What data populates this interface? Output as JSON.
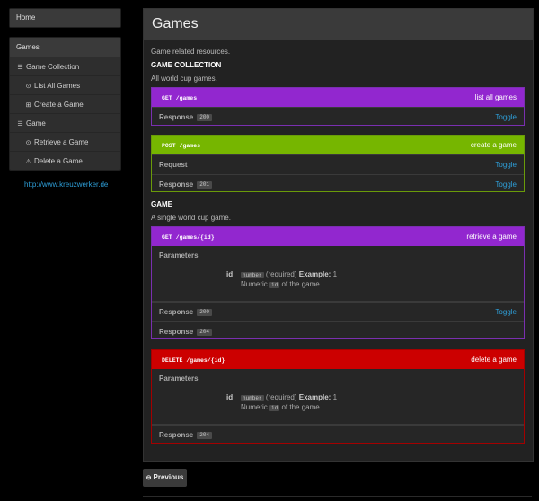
{
  "nav": {
    "home": "Home",
    "group_title": "Games",
    "items": [
      {
        "label": "Game Collection",
        "icon": "list-icon"
      },
      {
        "label": "List All Games",
        "icon": "circle-arrow-icon"
      },
      {
        "label": "Create a Game",
        "icon": "plus-square-icon"
      },
      {
        "label": "Game",
        "icon": "list-icon"
      },
      {
        "label": "Retrieve a Game",
        "icon": "circle-arrow-icon"
      },
      {
        "label": "Delete a Game",
        "icon": "warning-icon"
      }
    ],
    "external_link": "http://www.kreuzwerker.de"
  },
  "main": {
    "title": "Games",
    "intro": "Game related resources.",
    "sections": [
      {
        "title": "GAME COLLECTION",
        "description": "All world cup games."
      },
      {
        "title": "GAME",
        "description": "A single world cup game."
      }
    ],
    "resources": [
      {
        "method": "GET",
        "uri": "/games",
        "description": "list all games",
        "rows": [
          {
            "label": "Response",
            "code": "200",
            "toggle": "Toggle"
          }
        ]
      },
      {
        "method": "POST",
        "uri": "/games",
        "description": "create a game",
        "rows": [
          {
            "label": "Request",
            "toggle": "Toggle"
          },
          {
            "label": "Response",
            "code": "201",
            "toggle": "Toggle"
          }
        ]
      },
      {
        "method": "GET",
        "uri": "/games/{id}",
        "description": "retrieve a game",
        "parameters_label": "Parameters",
        "param": {
          "name": "id",
          "type": "number",
          "required": "(required)",
          "example_label": "Example:",
          "example": "1",
          "desc_pre": "Numeric",
          "desc_code": "id",
          "desc_post": "of the game."
        },
        "rows": [
          {
            "label": "Response",
            "code": "200",
            "toggle": "Toggle"
          },
          {
            "label": "Response",
            "code": "204"
          }
        ]
      },
      {
        "method": "DELETE",
        "uri": "/games/{id}",
        "description": "delete a game",
        "parameters_label": "Parameters",
        "param": {
          "name": "id",
          "type": "number",
          "required": "(required)",
          "example_label": "Example:",
          "example": "1",
          "desc_pre": "Numeric",
          "desc_code": "id",
          "desc_post": "of the game."
        },
        "rows": [
          {
            "label": "Response",
            "code": "204"
          }
        ]
      }
    ],
    "previous_label": "Previous"
  },
  "colors": {
    "get": "#9227cf",
    "post": "#76b600",
    "delete": "#cc0000",
    "link": "#2e9fd9"
  }
}
